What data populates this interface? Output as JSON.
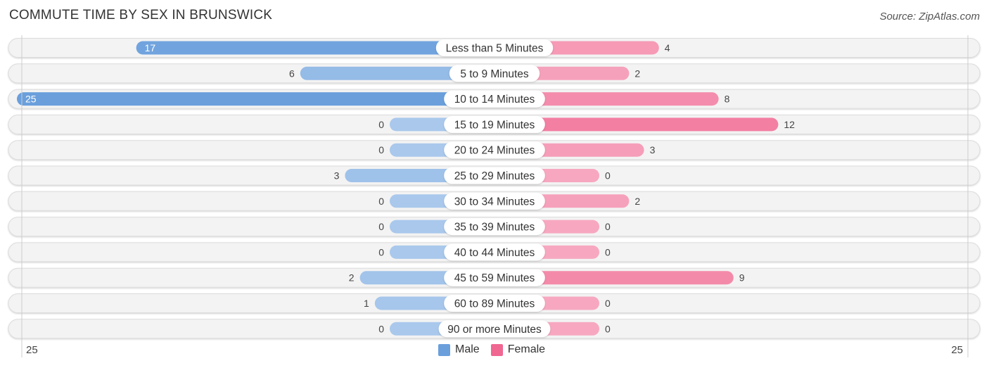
{
  "title": "COMMUTE TIME BY SEX IN BRUNSWICK",
  "source": "Source: ZipAtlas.com",
  "colors": {
    "male": "#6a9fdc",
    "male_light": "#a9c8ec",
    "female": "#f06792",
    "female_light": "#f7a8c0",
    "row_bg": "#f3f3f3"
  },
  "legend": [
    {
      "label": "Male",
      "color": "#6a9fdc"
    },
    {
      "label": "Female",
      "color": "#f06792"
    }
  ],
  "axis": {
    "left_label": "25",
    "right_label": "25"
  },
  "chart_data": {
    "type": "bar",
    "orientation": "horizontal-diverging",
    "title": "COMMUTE TIME BY SEX IN BRUNSWICK",
    "categories": [
      "Less than 5 Minutes",
      "5 to 9 Minutes",
      "10 to 14 Minutes",
      "15 to 19 Minutes",
      "20 to 24 Minutes",
      "25 to 29 Minutes",
      "30 to 34 Minutes",
      "35 to 39 Minutes",
      "40 to 44 Minutes",
      "45 to 59 Minutes",
      "60 to 89 Minutes",
      "90 or more Minutes"
    ],
    "series": [
      {
        "name": "Male",
        "values": [
          17,
          6,
          25,
          0,
          0,
          3,
          0,
          0,
          0,
          2,
          1,
          0
        ]
      },
      {
        "name": "Female",
        "values": [
          4,
          2,
          8,
          12,
          3,
          0,
          2,
          0,
          0,
          9,
          0,
          0
        ]
      }
    ],
    "xlim": [
      -25,
      25
    ],
    "axis_tick_labels": [
      "25",
      "25"
    ],
    "legend_position": "bottom-center"
  }
}
